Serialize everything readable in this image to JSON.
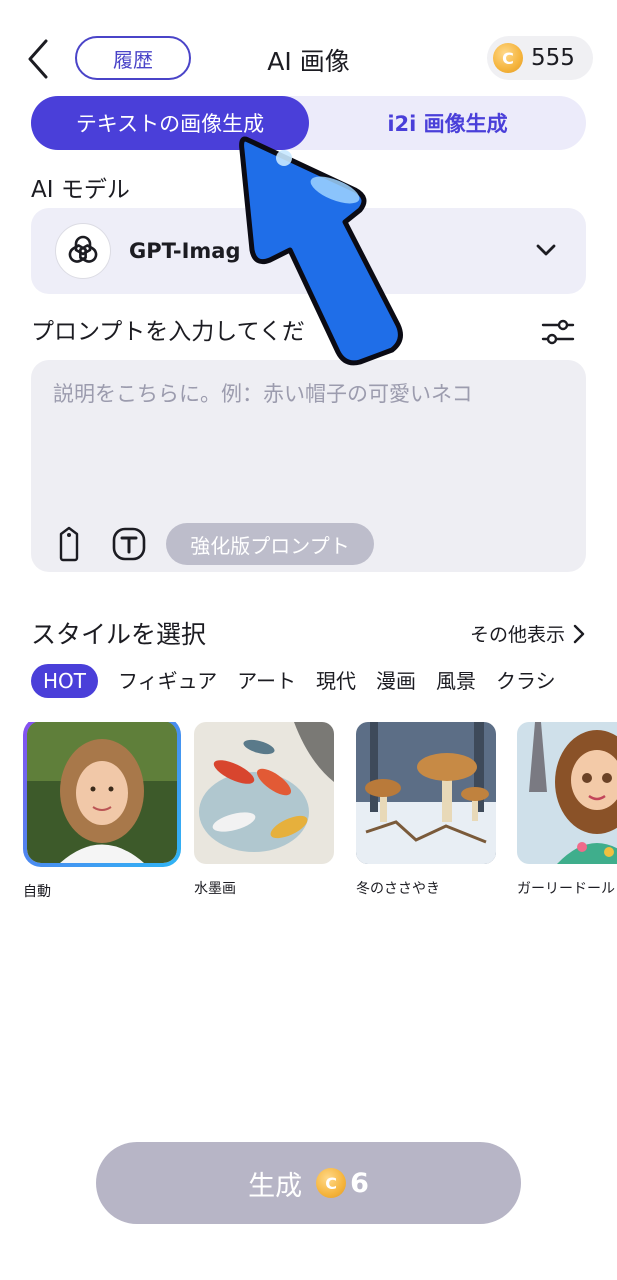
{
  "header": {
    "history_label": "履歴",
    "title": "AI 画像",
    "coin_symbol": "C",
    "coin_balance": "555"
  },
  "tabs": [
    {
      "label": "テキストの画像生成",
      "active": true
    },
    {
      "label": "i2i 画像生成",
      "active": false
    }
  ],
  "model": {
    "section_label": "AI モデル",
    "name": "GPT-Imag",
    "logo_icon": "openai-logo-icon"
  },
  "prompt": {
    "section_label": "プロンプトを入力してくだ",
    "placeholder": "説明をこちらに。例：赤い帽子の可愛いネコ",
    "enhance_label": "強化版プロンプト"
  },
  "styles": {
    "title": "スタイルを選択",
    "more_label": "その他表示",
    "categories": [
      "HOT",
      "フィギュア",
      "アート",
      "現代",
      "漫画",
      "風景",
      "クラシ"
    ],
    "active_category": "HOT",
    "cards": [
      {
        "label": "自動",
        "selected": true
      },
      {
        "label": "水墨画",
        "selected": false
      },
      {
        "label": "冬のささやき",
        "selected": false
      },
      {
        "label": "ガーリードール",
        "selected": false
      }
    ]
  },
  "generate": {
    "label": "生成",
    "coin_symbol": "C",
    "cost": "6"
  },
  "colors": {
    "accent": "#4a3fd9",
    "tab_bg": "#ecebfa",
    "disabled": "#b7b5c6",
    "arrow": "#1f6ee8"
  }
}
